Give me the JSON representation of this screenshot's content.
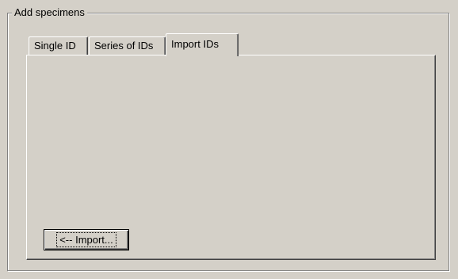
{
  "group": {
    "title": "Add specimens"
  },
  "tabs": [
    {
      "label": "Single ID",
      "active": false
    },
    {
      "label": "Series of IDs",
      "active": false
    },
    {
      "label": "Import IDs",
      "active": true
    }
  ],
  "import_panel": {
    "import_button_label": "<-- Import..."
  }
}
